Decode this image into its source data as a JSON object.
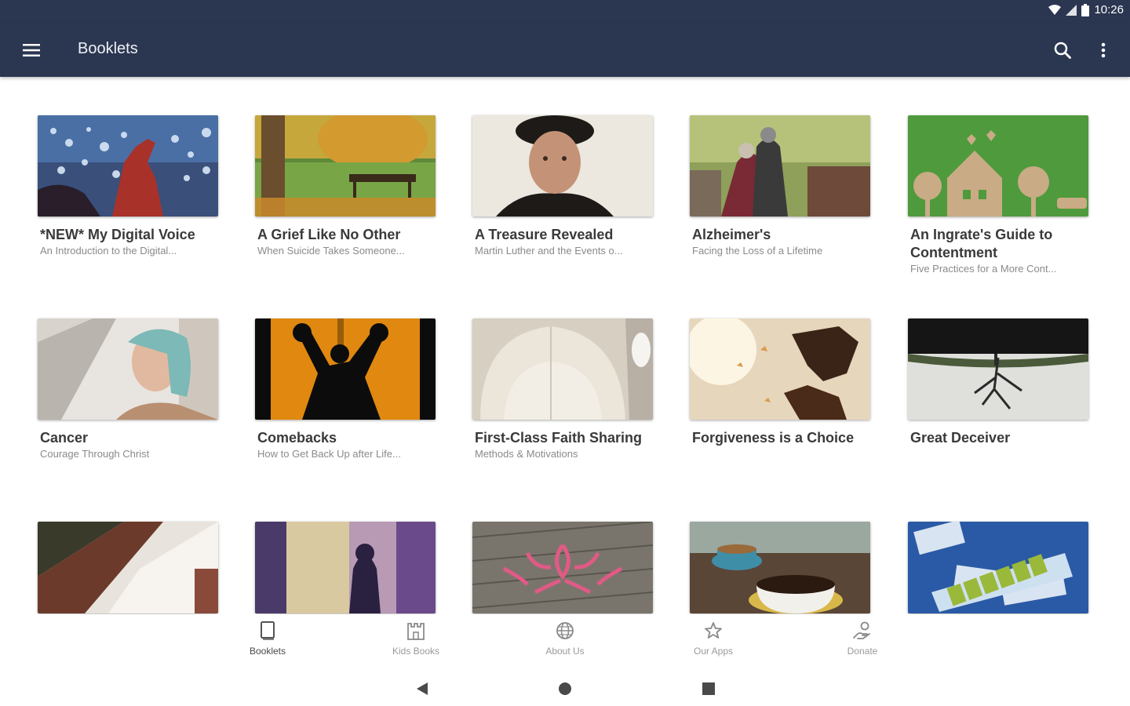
{
  "status": {
    "time": "10:26",
    "icons": [
      "wifi-icon",
      "signal-icon",
      "battery-icon"
    ]
  },
  "appbar": {
    "title": "Booklets",
    "menu_icon": "menu-icon",
    "search_icon": "search-icon",
    "more_icon": "more-vert-icon",
    "color": "#2b3651"
  },
  "booklets": [
    {
      "title": "*NEW* My Digital Voice",
      "subtitle": "An Introduction to the Digital..."
    },
    {
      "title": "A Grief Like No Other",
      "subtitle": "When Suicide Takes Someone..."
    },
    {
      "title": "A Treasure Revealed",
      "subtitle": "Martin Luther and the Events o..."
    },
    {
      "title": "Alzheimer's",
      "subtitle": "Facing the Loss of a Lifetime"
    },
    {
      "title": "An Ingrate's Guide to Contentment",
      "subtitle": "Five Practices for a More Cont..."
    },
    {
      "title": "Cancer",
      "subtitle": "Courage Through Christ"
    },
    {
      "title": "Comebacks",
      "subtitle": "How to Get Back Up after Life..."
    },
    {
      "title": "First-Class Faith Sharing",
      "subtitle": "Methods & Motivations"
    },
    {
      "title": "Forgiveness is a Choice",
      "subtitle": ""
    },
    {
      "title": "Great Deceiver",
      "subtitle": ""
    }
  ],
  "bottom_nav": [
    {
      "label": "Booklets",
      "icon": "book-icon",
      "active": true
    },
    {
      "label": "Kids Books",
      "icon": "castle-icon",
      "active": false
    },
    {
      "label": "About Us",
      "icon": "globe-icon",
      "active": false
    },
    {
      "label": "Our Apps",
      "icon": "star-icon",
      "active": false
    },
    {
      "label": "Donate",
      "icon": "donate-hand-icon",
      "active": false
    }
  ],
  "system_nav": [
    "back-icon",
    "home-icon",
    "recents-icon"
  ]
}
